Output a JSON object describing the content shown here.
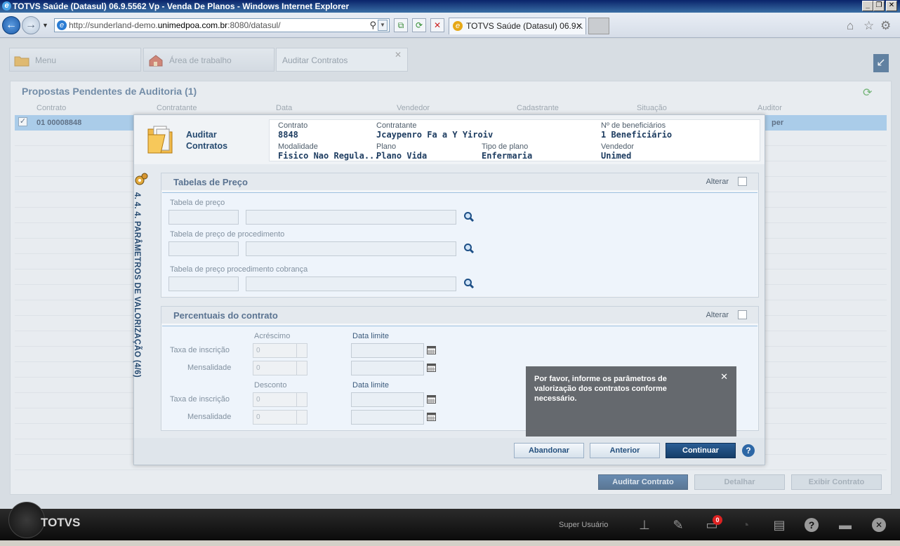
{
  "window": {
    "title": "TOTVS Saúde (Datasul) 06.9.5562 Vp - Venda De Planos - Windows Internet Explorer",
    "url_prefix": "http://sunderland-demo.",
    "url_domain": "unimedpoa.com.br",
    "url_suffix": ":8080/datasul/",
    "tab_label": "TOTVS Saúde (Datasul) 06.9...",
    "tab_close": "✕"
  },
  "app_tabs": [
    {
      "label": "Menu"
    },
    {
      "label": "Área de trabalho"
    },
    {
      "label": "Auditar Contratos",
      "close": "✕"
    }
  ],
  "panel": {
    "title": "Propostas Pendentes de Auditoria (1)",
    "columns": [
      "Contrato",
      "Contratante",
      "Data",
      "Vendedor",
      "Cadastrante",
      "Situação",
      "Auditor"
    ],
    "row": {
      "contrato": "01 00008848",
      "auditor": "per",
      "checked": "✓"
    },
    "buttons": {
      "auditar": "Auditar Contrato",
      "detalhar": "Detalhar",
      "exibir": "Exibir Contrato"
    }
  },
  "modal": {
    "title_line1": "Auditar",
    "title_line2": "Contratos",
    "info": {
      "contrato_label": "Contrato",
      "contrato_value": "8848",
      "contratante_label": "Contratante",
      "contratante_value": "Jcaypenro Fa a  Y  Yiroiv",
      "benef_label": "Nº de beneficiários",
      "benef_value": "1 Beneficiário",
      "modalidade_label": "Modalidade",
      "modalidade_value": "Fisico Nao Regula...",
      "plano_label": "Plano",
      "plano_value": "Plano Vida",
      "tipo_label": "Tipo de plano",
      "tipo_value": "Enfermaria",
      "vendedor_label": "Vendedor",
      "vendedor_value": "Unimed"
    },
    "step_title": "4. 4. 4. PARÂMETROS DE VALORIZAÇÃO (4/6)",
    "tabelas": {
      "title": "Tabelas de Preço",
      "alterar": "Alterar",
      "field1": "Tabela de preço",
      "field2": "Tabela de preço de procedimento",
      "field3": "Tabela de preço procedimento cobrança"
    },
    "percentuais": {
      "title": "Percentuais do contrato",
      "alterar": "Alterar",
      "acrescimo": "Acréscimo",
      "desconto": "Desconto",
      "data_limite": "Data limite",
      "taxa": "Taxa de inscrição",
      "mensalidade": "Mensalidade",
      "zero": "0"
    },
    "footer": {
      "abandonar": "Abandonar",
      "anterior": "Anterior",
      "continuar": "Continuar",
      "help": "?"
    }
  },
  "tooltip": {
    "text": "Por favor, informe os parâmetros de valorização dos contratos conforme necessário.",
    "close": "✕"
  },
  "taskbar": {
    "logo": "TOTVS",
    "user": "Super Usuário",
    "badge": "0"
  }
}
